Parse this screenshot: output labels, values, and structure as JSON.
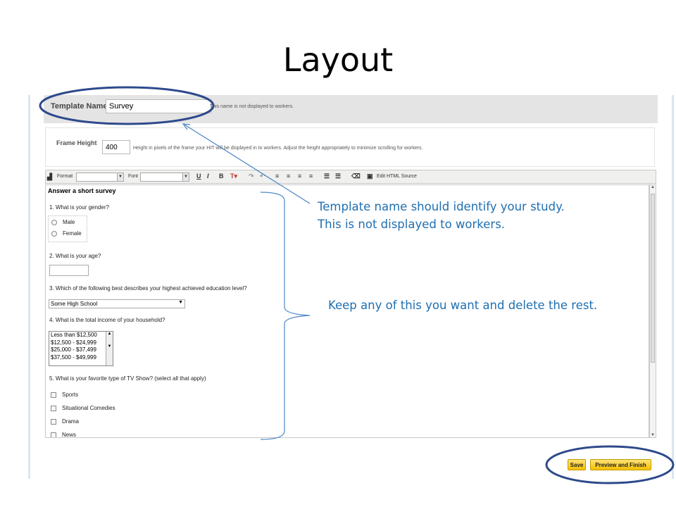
{
  "slide": {
    "title": "Layout"
  },
  "template_name": {
    "label": "Template Name:",
    "value": "Survey",
    "note": "This name is not displayed to workers."
  },
  "frame_height": {
    "label": "Frame Height",
    "value": "400",
    "note": "Height in pixels of the frame your HIT will be displayed in to workers. Adjust the height appropriately to minimize scrolling for workers."
  },
  "toolbar": {
    "format_label": "Format",
    "font_label": "Font",
    "edit_html_label": "Edit HTML Source"
  },
  "survey": {
    "title": "Answer a short survey",
    "q1": "1. What is your gender?",
    "gender_options": [
      "Male",
      "Female"
    ],
    "q2": "2. What is your age?",
    "q3": "3. Which of the following best describes your highest achieved education level?",
    "education_selected": "Some High School",
    "q4": "4. What is the total income of your household?",
    "income_options": [
      "Less than $12,500",
      "$12,500 - $24,999",
      "$25,000 - $37,499",
      "$37,500 - $49,999"
    ],
    "q5": "5. What is your favorite type of TV Show? (select all that apply)",
    "tv_options": [
      "Sports",
      "Situational Comedies",
      "Drama",
      "News"
    ]
  },
  "annotations": {
    "template_name_line1": "Template name should identify your study.",
    "template_name_line2": "This is not displayed to workers.",
    "keep_any": "Keep any of this you want and delete the rest."
  },
  "buttons": {
    "save": "Save",
    "preview_finish": "Preview and Finish"
  },
  "colors": {
    "annotation": "#1f6fb0",
    "circle": "#2e4a8c",
    "button": "#f5c000"
  }
}
